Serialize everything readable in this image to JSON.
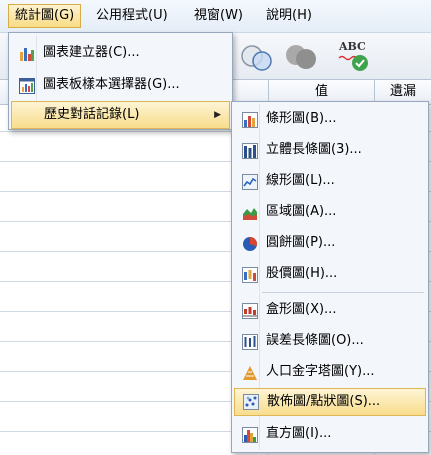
{
  "menubar": {
    "items": [
      {
        "label": "統計圖(G)",
        "active": true
      },
      {
        "label": "公用程式(U)"
      },
      {
        "label": "視窗(W)"
      },
      {
        "label": "說明(H)"
      }
    ]
  },
  "toolbar": {
    "icons": [
      "venn-circles-icon",
      "filled-circles-icon",
      "spell-check-icon"
    ],
    "spellcheck_text": "ABC"
  },
  "grid": {
    "columns": [
      "值",
      "遺漏"
    ]
  },
  "graphs_menu": {
    "items": [
      {
        "label": "圖表建立器(C)...",
        "icon": "chart-builder-icon"
      },
      {
        "label": "圖表板樣本選擇器(G)...",
        "icon": "template-chooser-icon"
      },
      {
        "label": "歷史對話記錄(L)",
        "icon": "",
        "submenu_arrow": "▶",
        "highlighted": true
      }
    ]
  },
  "legacy_submenu": {
    "items": [
      {
        "label": "條形圖(B)...",
        "icon": "bar-chart-icon"
      },
      {
        "label": "立體長條圖(3)...",
        "icon": "3d-bar-chart-icon"
      },
      {
        "label": "線形圖(L)...",
        "icon": "line-chart-icon"
      },
      {
        "label": "區域圖(A)...",
        "icon": "area-chart-icon"
      },
      {
        "label": "圓餅圖(P)...",
        "icon": "pie-chart-icon"
      },
      {
        "label": "股價圖(H)...",
        "icon": "high-low-chart-icon"
      },
      {
        "label": "盒形圖(X)...",
        "icon": "boxplot-icon"
      },
      {
        "label": "誤差長條圖(O)...",
        "icon": "error-bar-icon"
      },
      {
        "label": "人口金字塔圖(Y)...",
        "icon": "population-pyramid-icon"
      },
      {
        "label": "散佈圖/點狀圖(S)...",
        "icon": "scatter-dot-icon",
        "highlighted": true
      },
      {
        "label": "直方圖(I)...",
        "icon": "histogram-icon"
      }
    ]
  }
}
